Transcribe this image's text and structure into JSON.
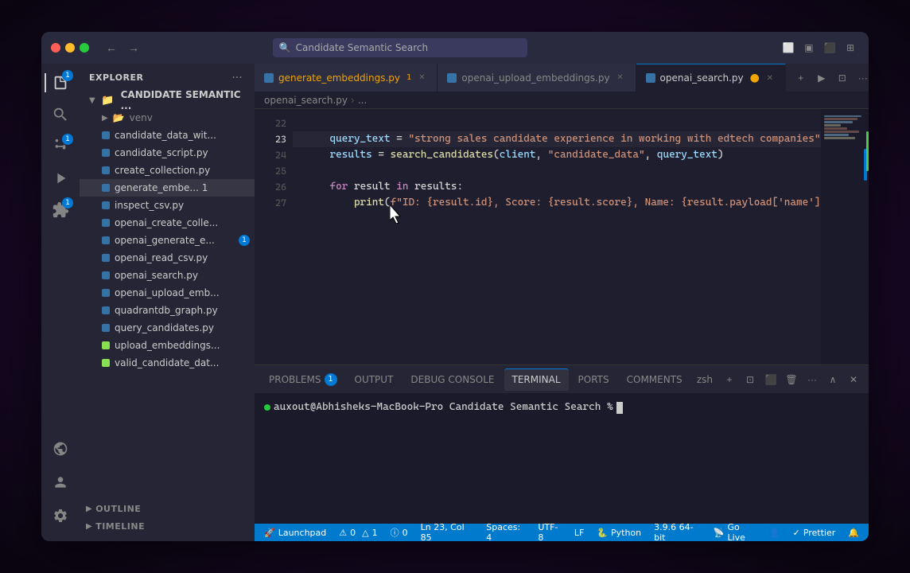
{
  "window": {
    "title": "Candidate Semantic Search"
  },
  "titlebar": {
    "back_label": "←",
    "forward_label": "→",
    "search_placeholder": "Candidate Semantic Search",
    "search_icon": "🔍"
  },
  "activity_bar": {
    "icons": [
      {
        "name": "explorer",
        "symbol": "📄",
        "active": true,
        "badge": null
      },
      {
        "name": "search",
        "symbol": "🔍",
        "active": false,
        "badge": null
      },
      {
        "name": "source-control",
        "symbol": "⎇",
        "active": false,
        "badge": "1"
      },
      {
        "name": "run-debug",
        "symbol": "▶",
        "active": false,
        "badge": null
      },
      {
        "name": "extensions",
        "symbol": "⊞",
        "active": false,
        "badge": "1"
      }
    ],
    "bottom_icons": [
      {
        "name": "remote",
        "symbol": "⧉"
      },
      {
        "name": "account",
        "symbol": "👤"
      },
      {
        "name": "settings",
        "symbol": "⚙"
      }
    ]
  },
  "sidebar": {
    "header_title": "EXPLORER",
    "more_icon": "···",
    "folder": {
      "name": "CANDIDATE SEMANTIC ...",
      "expanded": true
    },
    "files": [
      {
        "name": "venv",
        "type": "folder",
        "indent": 1
      },
      {
        "name": "candidate_data_wit...",
        "type": "py",
        "indent": 1
      },
      {
        "name": "candidate_script.py",
        "type": "py",
        "indent": 1
      },
      {
        "name": "create_collection.py",
        "type": "py",
        "indent": 1
      },
      {
        "name": "generate_embe... 1",
        "type": "py",
        "indent": 1,
        "active": true
      },
      {
        "name": "inspect_csv.py",
        "type": "py",
        "indent": 1
      },
      {
        "name": "openai_create_colle...",
        "type": "py",
        "indent": 1
      },
      {
        "name": "openai_generate_e...",
        "type": "py",
        "indent": 1,
        "badge": "1"
      },
      {
        "name": "openai_read_csv.py",
        "type": "py",
        "indent": 1
      },
      {
        "name": "openai_search.py",
        "type": "py",
        "indent": 1
      },
      {
        "name": "openai_upload_emb...",
        "type": "py",
        "indent": 1
      },
      {
        "name": "quadrantdb_graph.py",
        "type": "py",
        "indent": 1
      },
      {
        "name": "query_candidates.py",
        "type": "py",
        "indent": 1
      },
      {
        "name": "upload_embeddings...",
        "type": "csv",
        "indent": 1
      },
      {
        "name": "valid_candidate_dat...",
        "type": "csv",
        "indent": 1
      }
    ],
    "outline_label": "OUTLINE",
    "timeline_label": "TIMELINE"
  },
  "tabs": [
    {
      "name": "generate_embeddings.py",
      "type": "py",
      "active": false,
      "unsaved": false,
      "badge": "1"
    },
    {
      "name": "openai_upload_embeddings.py",
      "type": "py",
      "active": false,
      "unsaved": false
    },
    {
      "name": "openai_search.py",
      "type": "py",
      "active": true,
      "unsaved": true
    }
  ],
  "breadcrumb": {
    "file": "openai_search.py",
    "context": "..."
  },
  "code": {
    "lines": [
      {
        "num": 22,
        "content": "",
        "tokens": []
      },
      {
        "num": 23,
        "content": "    query_text = \"strong sales candidate experience in working with edtech companies\"",
        "tokens": [
          {
            "text": "    ",
            "class": "plain"
          },
          {
            "text": "query_text",
            "class": "var"
          },
          {
            "text": " = ",
            "class": "op"
          },
          {
            "text": "\"strong sales candidate experience in working with edtech companies\"",
            "class": "str"
          }
        ]
      },
      {
        "num": 24,
        "content": "    results = search_candidates(client, \"candidate_data\", query_text)",
        "tokens": [
          {
            "text": "    ",
            "class": "plain"
          },
          {
            "text": "results",
            "class": "var"
          },
          {
            "text": " = ",
            "class": "op"
          },
          {
            "text": "search_candidates",
            "class": "fn"
          },
          {
            "text": "(",
            "class": "plain"
          },
          {
            "text": "client",
            "class": "var"
          },
          {
            "text": ", ",
            "class": "plain"
          },
          {
            "text": "\"candidate_data\"",
            "class": "str"
          },
          {
            "text": ", ",
            "class": "plain"
          },
          {
            "text": "query_text",
            "class": "var"
          },
          {
            "text": ")",
            "class": "plain"
          }
        ]
      },
      {
        "num": 25,
        "content": "",
        "tokens": []
      },
      {
        "num": 26,
        "content": "    for result in results:",
        "tokens": [
          {
            "text": "    ",
            "class": "plain"
          },
          {
            "text": "for",
            "class": "kw"
          },
          {
            "text": " result ",
            "class": "plain"
          },
          {
            "text": "in",
            "class": "kw"
          },
          {
            "text": " results:",
            "class": "plain"
          }
        ]
      },
      {
        "num": 27,
        "content": "        print(f\"ID: {result.id}, Score: {result.score}, Name: {result.payload['name']}\")",
        "tokens": [
          {
            "text": "        ",
            "class": "plain"
          },
          {
            "text": "print",
            "class": "fn"
          },
          {
            "text": "(",
            "class": "plain"
          },
          {
            "text": "f\"ID: {result.id}, Score: {result.score}, Name: {result.payload['name']}\"",
            "class": "str"
          },
          {
            "text": ")",
            "class": "plain"
          }
        ]
      }
    ],
    "active_line": 23
  },
  "terminal": {
    "tabs": [
      {
        "label": "PROBLEMS",
        "active": false,
        "badge": "1"
      },
      {
        "label": "OUTPUT",
        "active": false
      },
      {
        "label": "DEBUG CONSOLE",
        "active": false
      },
      {
        "label": "TERMINAL",
        "active": true
      },
      {
        "label": "PORTS",
        "active": false
      },
      {
        "label": "COMMENTS",
        "active": false
      }
    ],
    "shell_label": "zsh",
    "prompt": "auxout@Abhisheks-MacBook-Pro Candidate Semantic Search %"
  },
  "status_bar": {
    "launchpad_label": "Launchpad",
    "errors": "0",
    "warnings": "1",
    "info": "0",
    "ln_col": "Ln 23, Col 85",
    "spaces": "Spaces: 4",
    "encoding": "UTF-8",
    "line_ending": "LF",
    "language": "Python",
    "python_version": "3.9.6 64-bit",
    "go_live": "Go Live",
    "prettier": "Prettier"
  },
  "colors": {
    "accent": "#007acc",
    "active_tab_border": "#007acc",
    "sidebar_bg": "#252535",
    "editor_bg": "#1e1e2e",
    "terminal_bg": "#1a1a2a",
    "titlebar_bg": "#2a2a3e"
  }
}
